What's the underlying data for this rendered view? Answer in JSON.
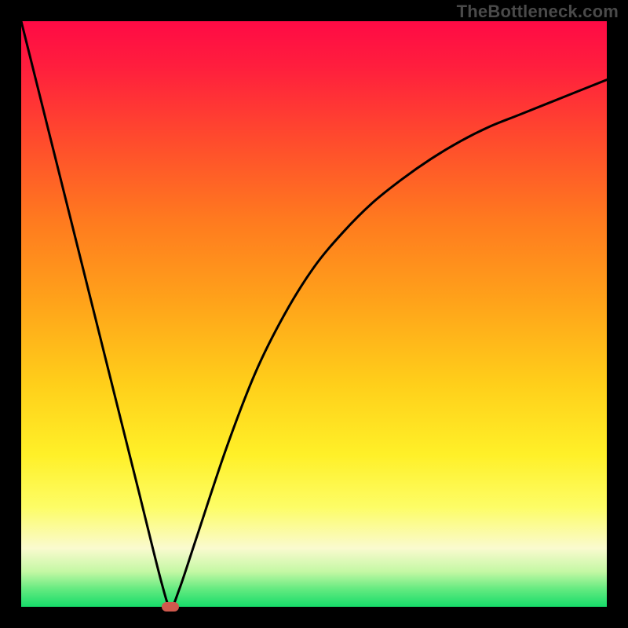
{
  "watermark": "TheBottleneck.com",
  "colors": {
    "page_bg": "#000000",
    "watermark_text": "#4a4a4a",
    "gradient_stops": [
      "#ff0a45",
      "#ff1f3d",
      "#ff4a2d",
      "#ff7a1f",
      "#ffa31a",
      "#ffcf1a",
      "#fff028",
      "#fdfd66",
      "#fafacf",
      "#c4f8a4",
      "#63ea80",
      "#16dc6a"
    ],
    "curve_stroke": "#000000",
    "marker_fill": "#cf594d"
  },
  "chart_data": {
    "type": "line",
    "title": "",
    "xlabel": "",
    "ylabel": "",
    "xlim": [
      0,
      100
    ],
    "ylim": [
      0,
      100
    ],
    "notes": "Heat gradient background (magenta-red at top through yellow to green at bottom) with a single black curve forming a sharp V whose minimum is near x≈25 at y≈0, the left branch rises nearly linearly to the top-left, and the right branch is a concave-up curve asymptotically approaching ~y≈90 at x=100. A small rounded red marker sits at the minimum.",
    "series": [
      {
        "name": "bottleneck-curve",
        "x": [
          0,
          5,
          10,
          15,
          20,
          24,
          25.5,
          27,
          30,
          35,
          40,
          45,
          50,
          55,
          60,
          65,
          70,
          75,
          80,
          85,
          90,
          95,
          100
        ],
        "y": [
          100,
          80,
          60,
          40,
          20,
          4,
          0,
          3,
          12,
          27,
          40,
          50,
          58,
          64,
          69,
          73,
          76.5,
          79.5,
          82,
          84,
          86,
          88,
          90
        ]
      }
    ],
    "marker": {
      "x": 25.5,
      "y": 0
    }
  }
}
